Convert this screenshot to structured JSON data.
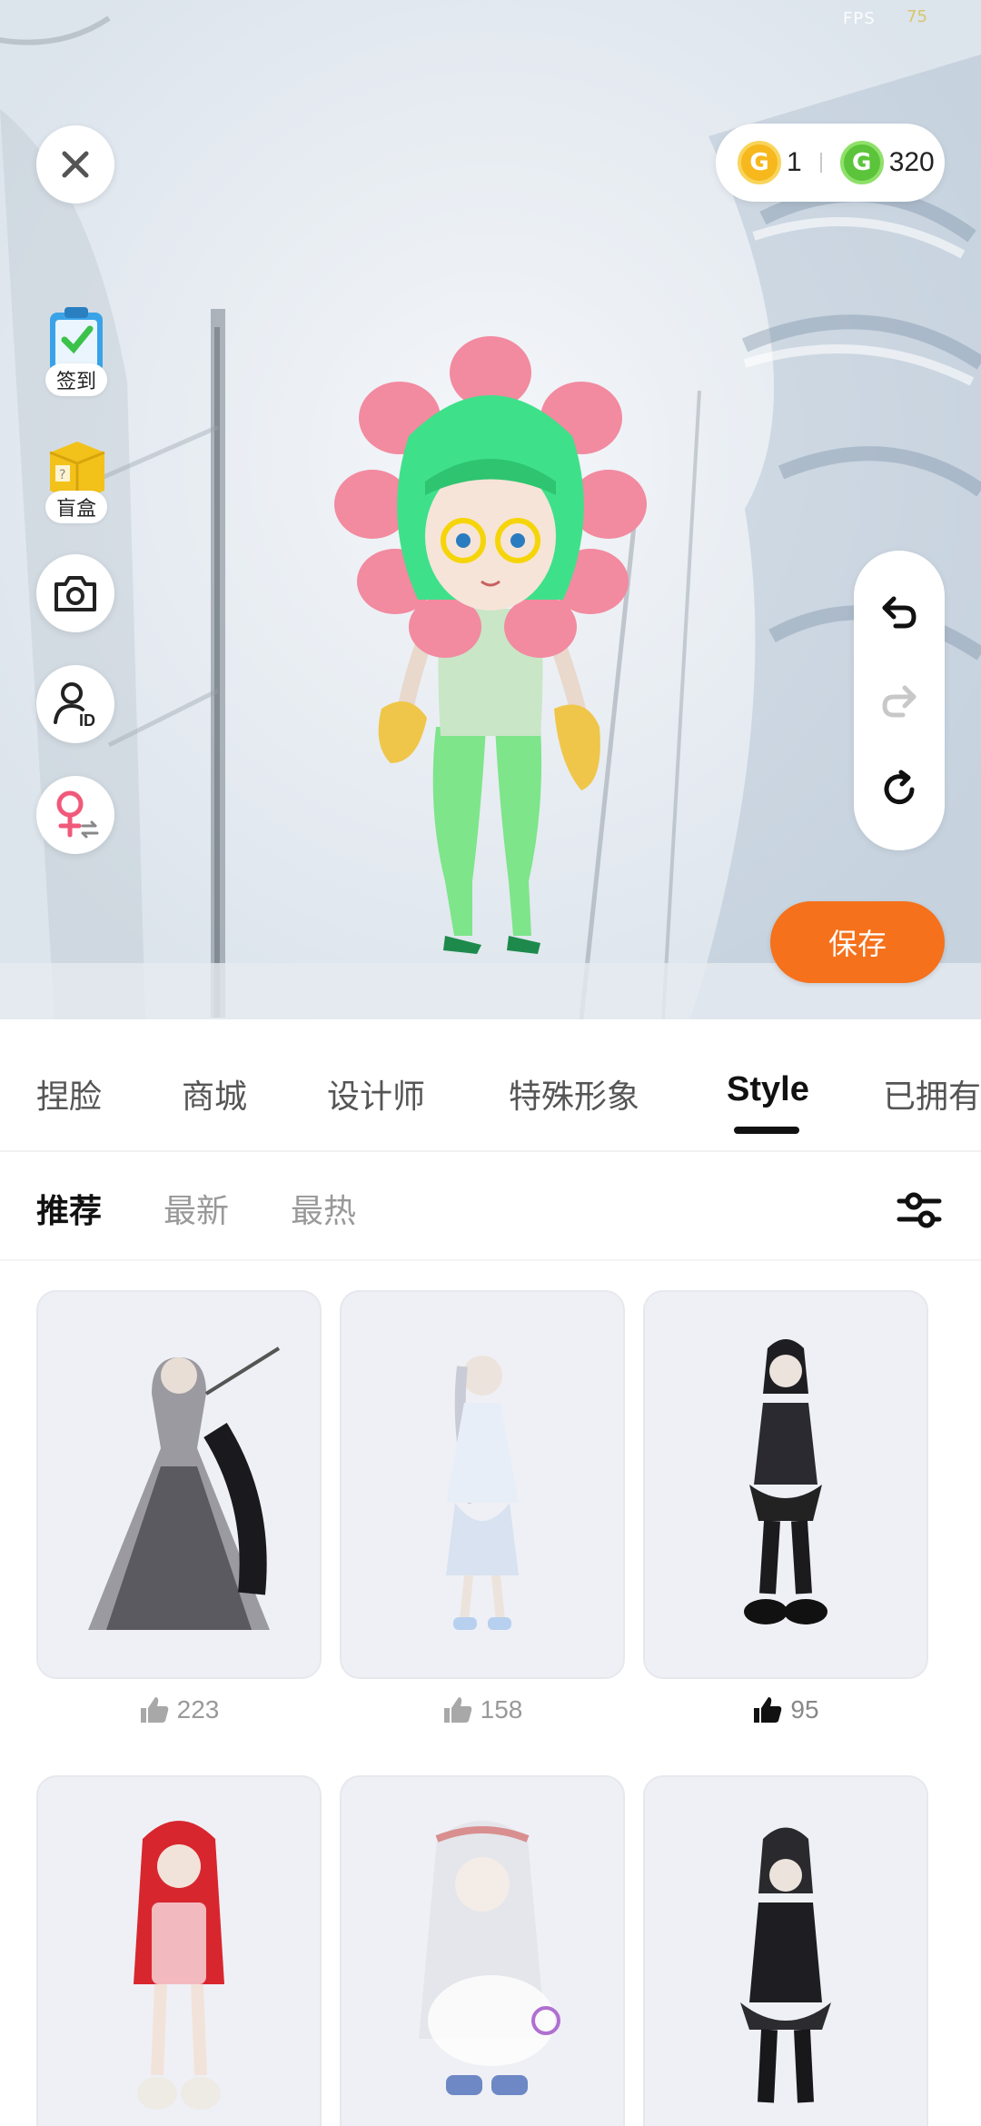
{
  "status": {
    "fps_label": "FPS",
    "fps_value": "75"
  },
  "currency": {
    "gold_value": "1",
    "green_value": "320"
  },
  "side_buttons": {
    "checkin_label": "签到",
    "blindbox_label": "盲盒"
  },
  "actions": {
    "save_label": "保存"
  },
  "tabs": [
    {
      "label": "捏脸"
    },
    {
      "label": "商城"
    },
    {
      "label": "设计师"
    },
    {
      "label": "特殊形象"
    },
    {
      "label": "Style"
    },
    {
      "label": "已拥有"
    }
  ],
  "subtabs": [
    {
      "label": "推荐"
    },
    {
      "label": "最新"
    },
    {
      "label": "最热"
    }
  ],
  "outfits": [
    {
      "likes": "223"
    },
    {
      "likes": "158"
    },
    {
      "likes": "95"
    },
    {
      "likes": ""
    },
    {
      "likes": ""
    },
    {
      "likes": ""
    }
  ],
  "colors": {
    "accent": "#f5711b",
    "coin_gold": "#f6b81c",
    "coin_green": "#5bc43a"
  }
}
